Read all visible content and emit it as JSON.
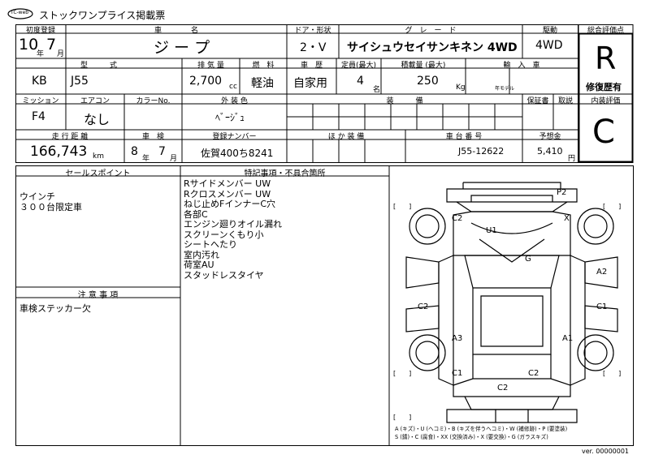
{
  "header": {
    "logo_text": "TC-web",
    "title": "ストックワンプライス掲載票"
  },
  "row1_labels": {
    "first_reg": "初度登録",
    "car_name": "車　　　　名",
    "door_shape": "ドア・形状",
    "grade": "グ　レ　ー　ド",
    "drive": "駆動",
    "overall": "総合評価点"
  },
  "row1_values": {
    "year": "10",
    "year_unit": "年",
    "month": "7",
    "month_unit": "月",
    "car_name": "ジ ー プ",
    "door_shape": "2・V",
    "grade": "サイシュウセイサンキネン 4WD",
    "drive": "4WD",
    "overall_score": "R",
    "overall_note": "修復歴有"
  },
  "row2_labels": {
    "model": "型　　　式",
    "displacement": "排 気 量",
    "fuel": "燃　料",
    "history": "車　歴",
    "capacity": "定員(最大)",
    "load": "積載量 (最大)",
    "import": "輸　入　車"
  },
  "row2_values": {
    "model_a": "KB",
    "model_b": "J55",
    "displacement": "2,700",
    "displacement_unit": "cc",
    "fuel": "軽油",
    "history": "自家用",
    "capacity": "4",
    "capacity_unit": "名",
    "load": "250",
    "load_unit": "Kg",
    "model_year_label": "年モデル"
  },
  "row3_labels": {
    "mission": "ミッション",
    "aircon": "エアコン",
    "color_no": "カラーNo.",
    "exterior_color": "外 装 色",
    "equipment": "装　　　備",
    "warranty": "保証書",
    "manual": "取説",
    "interior": "内装評価"
  },
  "row3_values": {
    "mission": "F4",
    "aircon": "なし",
    "exterior_color": "ﾍﾞｰｼﾞｭ",
    "interior_score": "C"
  },
  "row4_labels": {
    "mileage": "走 行 距 離",
    "inspection": "車　検",
    "plate": "登録ナンバー",
    "other_equipment": "ほ か 装 備",
    "chassis_no": "車 台 番 号",
    "price": "予想金"
  },
  "row4_values": {
    "mileage": "166,743",
    "mileage_unit": "km",
    "insp_year": "8",
    "insp_year_unit": "年",
    "insp_month": "7",
    "insp_month_unit": "月",
    "plate": "佐賀400ち8241",
    "chassis_no": "J55-12622",
    "price": "5,410",
    "price_unit": "円"
  },
  "sales": {
    "header": "セールスポイント",
    "lines": [
      "ウインチ",
      "３００台限定車"
    ]
  },
  "caution": {
    "header": "注 意 事 項",
    "lines": [
      "車検ステッカー欠"
    ]
  },
  "special": {
    "header": "特記事項・不具合箇所",
    "lines": [
      "Rサイドメンバー UW",
      "Rクロスメンバー UW",
      "ねじ止めFインナーC穴",
      "各部C",
      "エンジン廻りオイル漏れ",
      "スクリーンくもり小",
      "シートへたり",
      "室内汚れ",
      "荷室AU",
      "スタッドレスタイヤ"
    ]
  },
  "diagram": {
    "marks": {
      "p2": "P2",
      "c2_top": "C2",
      "x": "X",
      "u1": "U1",
      "g": "G",
      "a2": "A2",
      "c2_left": "C2",
      "c1_right": "C1",
      "a3": "A3",
      "a1": "A1",
      "c1_left": "C1",
      "c2_mid": "C2",
      "c2_bottom": "C2"
    },
    "bracket": "[　　]"
  },
  "legend": {
    "line1": "A (キズ)・U (ヘコミ)・B (キズを伴うヘコミ)・W (補修跡)・P (要塗装)",
    "line2": "S (錆)・C (腐食)・XX (交換済み)・X (要交換)・G (ガラスキズ)"
  },
  "footer": {
    "version": "ver. 00000001"
  }
}
